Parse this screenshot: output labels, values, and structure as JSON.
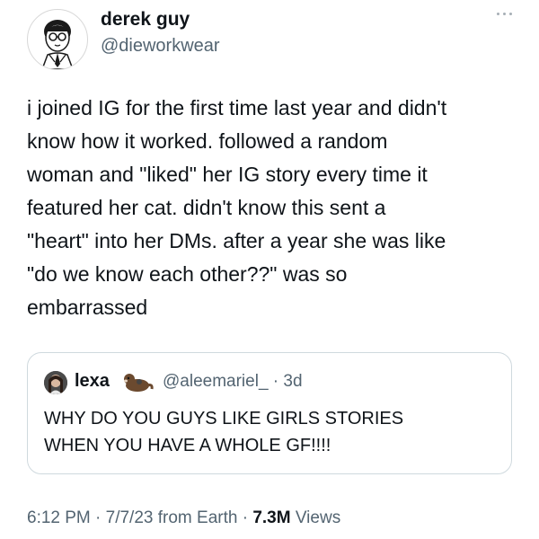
{
  "author": {
    "name": "derek guy",
    "handle": "@dieworkwear",
    "avatar_icon": "sketch-portrait-avatar"
  },
  "more_icon": "ellipsis-icon",
  "tweet": {
    "lines": [
      "i joined IG for the first time last year and didn't",
      "know how it worked. followed a random",
      "woman and \"liked\" her IG story every time it",
      "featured her cat. didn't know this sent a",
      "\"heart\" into her DMs. after a year she was like",
      "\"do we know each other??\" was so",
      "embarrassed"
    ]
  },
  "quoted": {
    "name": "lexa",
    "emoji_icon": "otter-emoji-icon",
    "handle_time": "@aleemariel_ · 3d",
    "lines": [
      "WHY DO YOU GUYS LIKE GIRLS STORIES",
      "WHEN YOU HAVE A WHOLE GF!!!!"
    ]
  },
  "meta": {
    "timestamp": "6:12 PM · 7/7/23 from Earth · ",
    "views_count": "7.3M",
    "views_label": " Views"
  },
  "colors": {
    "text": "#0f1419",
    "secondary": "#536471",
    "border": "#cfd9de"
  }
}
